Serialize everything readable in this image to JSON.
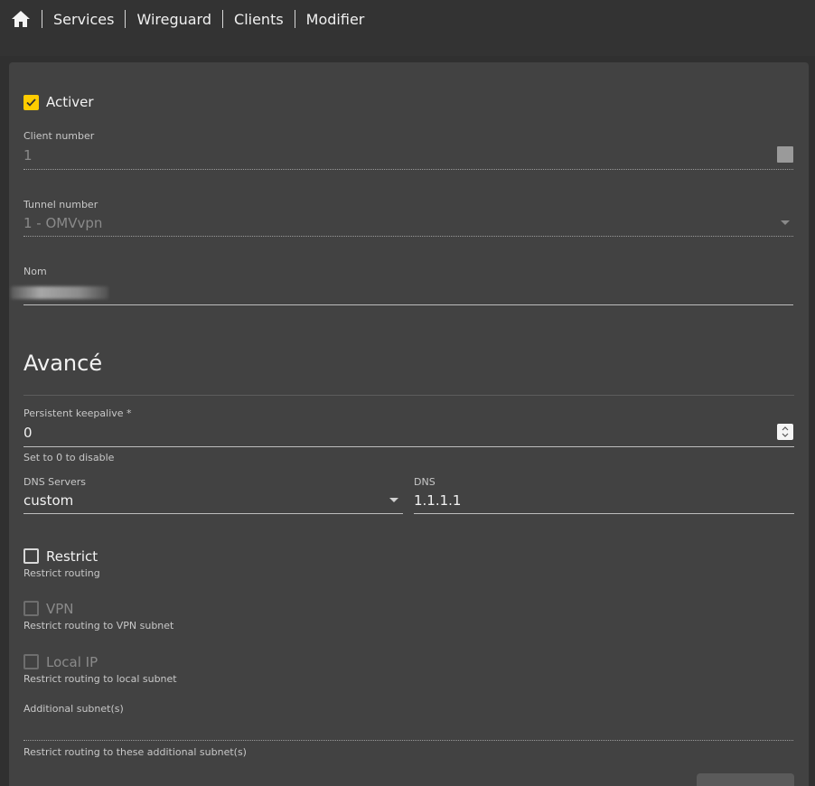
{
  "breadcrumb": {
    "home_icon": "home-icon",
    "items": [
      "Services",
      "Wireguard",
      "Clients",
      "Modifier"
    ]
  },
  "form": {
    "enable": {
      "label": "Activer",
      "checked": true
    },
    "client_number": {
      "label": "Client number",
      "value": "1"
    },
    "tunnel_number": {
      "label": "Tunnel number",
      "value": "1 - OMVvpn"
    },
    "name": {
      "label": "Nom",
      "value": ""
    },
    "advanced_title": "Avancé",
    "keepalive": {
      "label": "Persistent keepalive *",
      "value": "0",
      "hint": "Set to 0 to disable"
    },
    "dns_servers": {
      "label": "DNS Servers",
      "value": "custom"
    },
    "dns": {
      "label": "DNS",
      "value": "1.1.1.1"
    },
    "restrict": {
      "label": "Restrict",
      "hint": "Restrict routing",
      "checked": false
    },
    "vpn": {
      "label": "VPN",
      "hint": "Restrict routing to VPN subnet",
      "checked": false
    },
    "local_ip": {
      "label": "Local IP",
      "hint": "Restrict routing to local subnet",
      "checked": false
    },
    "subnets": {
      "label": "Additional subnet(s)",
      "value": "",
      "hint": "Restrict routing to these additional subnet(s)"
    }
  },
  "colors": {
    "accent": "#ffcc00",
    "background": "#303030",
    "card": "#424242"
  }
}
